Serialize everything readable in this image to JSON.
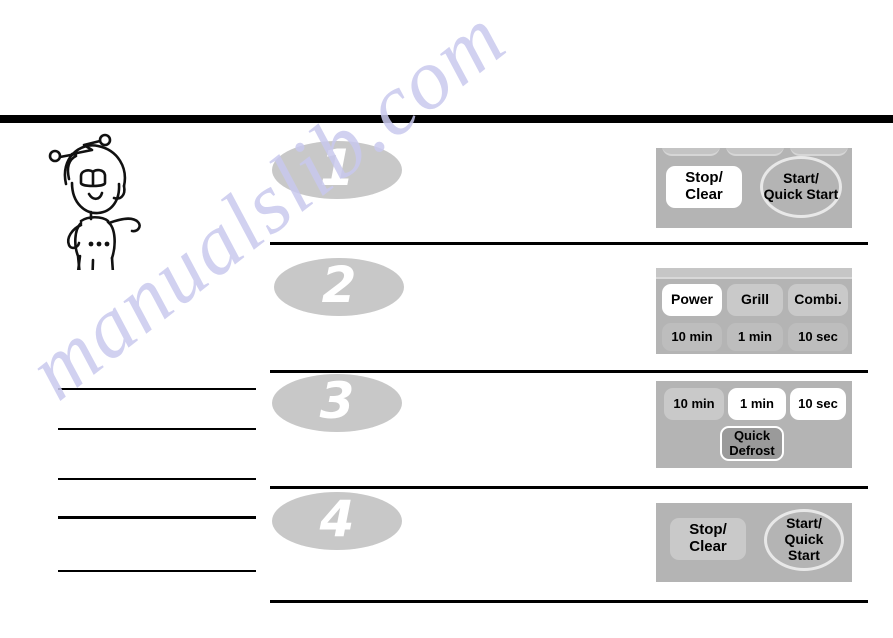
{
  "page": {
    "watermark": "manualslib.com",
    "mascot_alt": "cartoon-chef-robot-mascot"
  },
  "notes": {
    "lines": [
      "",
      "",
      "",
      "",
      ""
    ]
  },
  "steps": [
    {
      "number": "1",
      "panel": {
        "type": "stop-start",
        "buttons": [
          {
            "name": "stop-clear-button",
            "lines": [
              "Stop/",
              "Clear"
            ],
            "style": "white-rect"
          },
          {
            "name": "start-quick-start-button",
            "lines": [
              "Start/",
              "Quick Start"
            ],
            "style": "circle"
          }
        ]
      }
    },
    {
      "number": "2",
      "panel": {
        "type": "power-grill-combi",
        "buttons": [
          {
            "name": "power-button",
            "lines": [
              "Power"
            ],
            "style": "white-rect"
          },
          {
            "name": "grill-button",
            "lines": [
              "Grill"
            ],
            "style": "gray-rect"
          },
          {
            "name": "combi-button",
            "lines": [
              "Combi."
            ],
            "style": "gray-rect"
          },
          {
            "name": "ten-min-button",
            "lines": [
              "10 min"
            ],
            "style": "flat-rect"
          },
          {
            "name": "one-min-button",
            "lines": [
              "1 min"
            ],
            "style": "flat-rect"
          },
          {
            "name": "ten-sec-button",
            "lines": [
              "10 sec"
            ],
            "style": "flat-rect"
          }
        ]
      }
    },
    {
      "number": "3",
      "panel": {
        "type": "time-defrost",
        "buttons": [
          {
            "name": "ten-min-button",
            "lines": [
              "10 min"
            ],
            "style": "gray-rect"
          },
          {
            "name": "one-min-button",
            "lines": [
              "1 min"
            ],
            "style": "white-rect"
          },
          {
            "name": "ten-sec-button",
            "lines": [
              "10 sec"
            ],
            "style": "white-rect"
          },
          {
            "name": "quick-defrost-button",
            "lines": [
              "Quick",
              "Defrost"
            ],
            "style": "dark-rect"
          }
        ]
      }
    },
    {
      "number": "4",
      "panel": {
        "type": "stop-start",
        "buttons": [
          {
            "name": "stop-clear-button",
            "lines": [
              "Stop/",
              "Clear"
            ],
            "style": "gray-rect"
          },
          {
            "name": "start-quick-start-button",
            "lines": [
              "Start/",
              "Quick Start"
            ],
            "style": "circle"
          }
        ]
      }
    }
  ],
  "colors": {
    "panel_bg": "#b4b4b4",
    "number_ellipse": "#c8c8c8",
    "rule": "#000000",
    "watermark": "#c9c9ee"
  }
}
